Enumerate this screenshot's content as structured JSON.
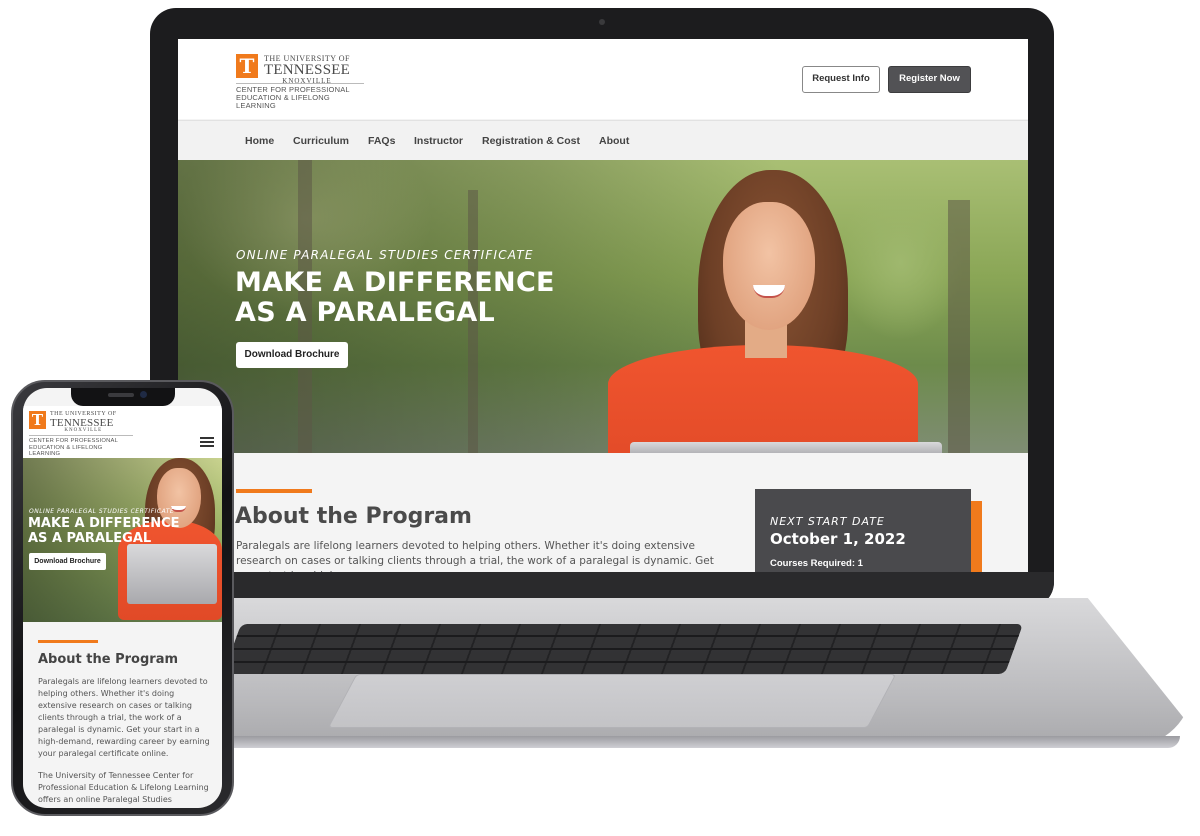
{
  "brand": {
    "university_top": "THE UNIVERSITY OF",
    "university_name": "TENNESSEE",
    "university_city": "KNOXVILLE",
    "center_line1": "CENTER FOR PROFESSIONAL",
    "center_line2": "EDUCATION & LIFELONG LEARNING",
    "logo_letter": "T",
    "accent_color": "#f07a1c"
  },
  "header": {
    "request_info_label": "Request Info",
    "register_now_label": "Register Now"
  },
  "nav": {
    "items": [
      {
        "label": "Home"
      },
      {
        "label": "Curriculum"
      },
      {
        "label": "FAQs"
      },
      {
        "label": "Instructor"
      },
      {
        "label": "Registration & Cost"
      },
      {
        "label": "About"
      }
    ]
  },
  "hero": {
    "eyebrow": "Online Paralegal Studies Certificate",
    "title": "MAKE A DIFFERENCE AS A PARALEGAL",
    "cta_label": "Download Brochure"
  },
  "about": {
    "title": "About the Program",
    "body": "Paralegals are lifelong learners devoted to helping others. Whether it's doing extensive research on cases or talking clients through a trial, the work of a paralegal is dynamic. Get your start in a high-"
  },
  "start_card": {
    "label": "Next Start Date",
    "date": "October 1, 2022",
    "courses": "Courses Required: 1"
  },
  "mobile": {
    "eyebrow": "Online Paralegal Studies Certificate",
    "title": "MAKE A DIFFERENCE AS A PARALEGAL",
    "cta_label": "Download Brochure",
    "about_title": "About the Program",
    "body_p1": "Paralegals are lifelong learners devoted to helping others. Whether it's doing extensive research on cases or talking clients through a trial, the work of a paralegal is dynamic. Get your start in a high-demand, rewarding career by earning your paralegal certificate online.",
    "body_p2": "The University of Tennessee Center for Professional Education & Lifelong Learning offers an online Paralegal Studies"
  }
}
